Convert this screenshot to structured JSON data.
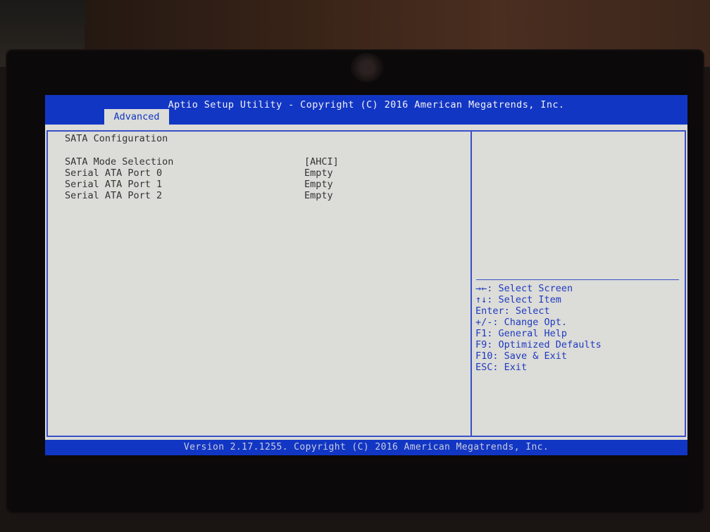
{
  "header": {
    "title": "Aptio Setup Utility - Copyright (C) 2016 American Megatrends, Inc.",
    "active_tab": "Advanced"
  },
  "main": {
    "section_title": "SATA Configuration",
    "rows": [
      {
        "label": "SATA Mode Selection",
        "value": "[AHCI]"
      },
      {
        "label": "Serial ATA Port 0",
        "value": "Empty"
      },
      {
        "label": "Serial ATA Port 1",
        "value": "Empty"
      },
      {
        "label": "Serial ATA Port 2",
        "value": "Empty"
      }
    ]
  },
  "help": {
    "keys": [
      "→←: Select Screen",
      "↑↓: Select Item",
      "Enter: Select",
      "+/-: Change Opt.",
      "F1: General Help",
      "F9: Optimized Defaults",
      "F10: Save & Exit",
      "ESC: Exit"
    ]
  },
  "footer": {
    "text": "Version 2.17.1255. Copyright (C) 2016 American Megatrends, Inc."
  },
  "colors": {
    "bios_blue": "#1236c4",
    "screen_gray": "#dcdcd8",
    "help_text_blue": "#1e3ac0"
  }
}
